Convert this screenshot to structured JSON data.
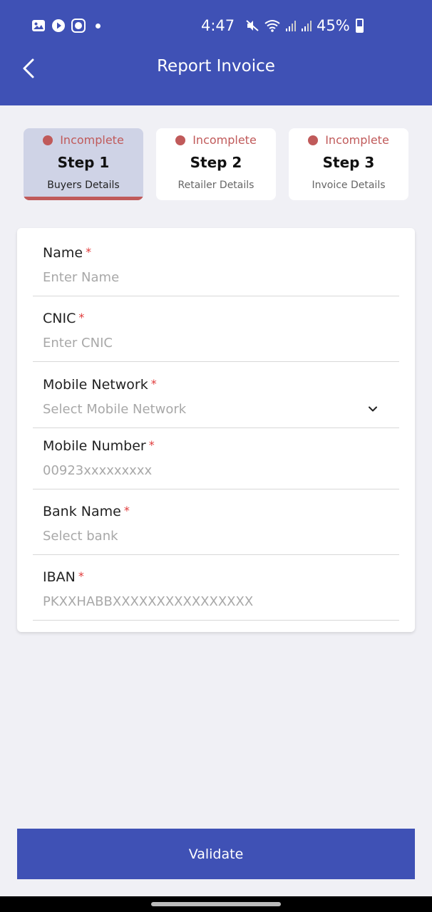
{
  "status_bar": {
    "time": "4:47",
    "battery": "45%",
    "icons": [
      "gallery-icon",
      "play-icon",
      "cb-icon",
      "dot-icon",
      "mute-icon",
      "wifi-icon",
      "signal-icon",
      "signal-icon",
      "battery-icon"
    ]
  },
  "header": {
    "title": "Report Invoice",
    "back_icon": "chevron-left-icon",
    "color": "#3f51b5"
  },
  "steps": [
    {
      "status": "Incomplete",
      "title": "Step 1",
      "subtitle": "Buyers Details",
      "active": true
    },
    {
      "status": "Incomplete",
      "title": "Step 2",
      "subtitle": "Retailer Details",
      "active": false
    },
    {
      "status": "Incomplete",
      "title": "Step 3",
      "subtitle": "Invoice Details",
      "active": false
    }
  ],
  "form": {
    "fields": [
      {
        "label": "Name",
        "required_mark": "*",
        "placeholder": "Enter Name",
        "value": ""
      },
      {
        "label": "CNIC",
        "required_mark": "*",
        "placeholder": "Enter CNIC",
        "value": ""
      },
      {
        "label": "Mobile Network",
        "required_mark": "*",
        "placeholder": "Select Mobile Network",
        "value": "",
        "dropdown": true
      },
      {
        "label": "Mobile Number",
        "required_mark": "*",
        "placeholder": "00923xxxxxxxxx",
        "value": ""
      },
      {
        "label": "Bank Name",
        "required_mark": "*",
        "placeholder": "Select bank",
        "value": ""
      },
      {
        "label": "IBAN",
        "required_mark": "*",
        "placeholder": "PKXXHABBXXXXXXXXXXXXXXXX",
        "value": ""
      }
    ]
  },
  "validate_button": {
    "label": "Validate"
  },
  "colors": {
    "primary": "#3f51b5",
    "incomplete": "#c05a5a",
    "required": "#e03a3a"
  }
}
